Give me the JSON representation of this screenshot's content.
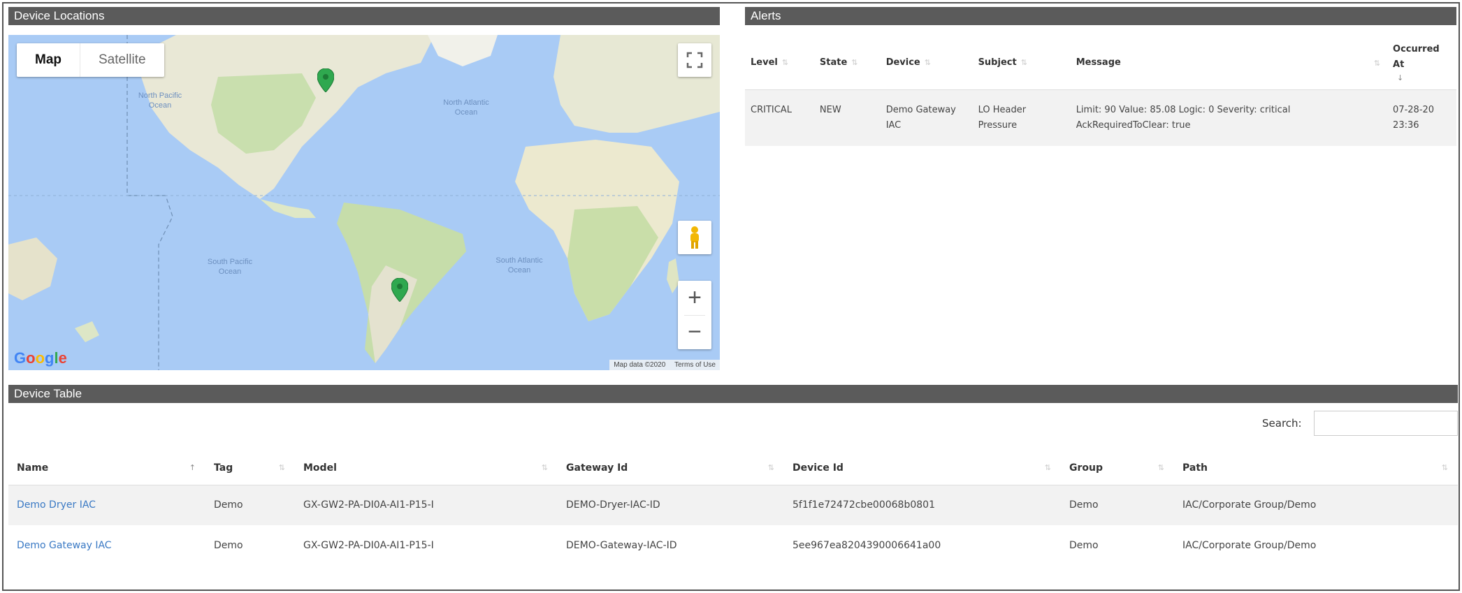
{
  "panels": {
    "device_locations": "Device Locations",
    "alerts": "Alerts",
    "device_table": "Device Table"
  },
  "map": {
    "type_options": [
      "Map",
      "Satellite"
    ],
    "selected_type": "Map",
    "zoom_in": "+",
    "zoom_out": "−",
    "logo": "Google",
    "attribution": [
      "Map data ©2020",
      "Terms of Use"
    ],
    "ocean_labels": [
      "North Pacific Ocean",
      "North Atlantic Ocean",
      "South Pacific Ocean",
      "South Atlantic Ocean"
    ],
    "pins": [
      "United States",
      "Argentina"
    ],
    "icons": [
      "fullscreen-icon",
      "pegman-icon",
      "map-pin-icon"
    ]
  },
  "alerts": {
    "columns": [
      "Level",
      "State",
      "Device",
      "Subject",
      "Message",
      "Occurred At"
    ],
    "rows": [
      {
        "level": "CRITICAL",
        "state": "NEW",
        "device": "Demo Gateway IAC",
        "subject": "LO Header Pressure",
        "message": "Limit: 90 Value: 85.08 Logic: 0 Severity: critical AckRequiredToClear: true",
        "occurred_at": "07-28-20 23:36"
      }
    ],
    "colors": {
      "critical": "#d9534f"
    }
  },
  "device_table": {
    "search_label": "Search:",
    "search_value": "",
    "columns": [
      "Name",
      "Tag",
      "Model",
      "Gateway Id",
      "Device Id",
      "Group",
      "Path"
    ],
    "rows": [
      {
        "name": "Demo Dryer IAC",
        "tag": "Demo",
        "model": "GX-GW2-PA-DI0A-AI1-P15-I",
        "gateway_id": "DEMO-Dryer-IAC-ID",
        "device_id": "5f1f1e72472cbe00068b0801",
        "group": "Demo",
        "path": "IAC/Corporate Group/Demo"
      },
      {
        "name": "Demo Gateway IAC",
        "tag": "Demo",
        "model": "GX-GW2-PA-DI0A-AI1-P15-I",
        "gateway_id": "DEMO-Gateway-IAC-ID",
        "device_id": "5ee967ea8204390006641a00",
        "group": "Demo",
        "path": "IAC/Corporate Group/Demo"
      }
    ],
    "link_color": "#3a79c4"
  }
}
